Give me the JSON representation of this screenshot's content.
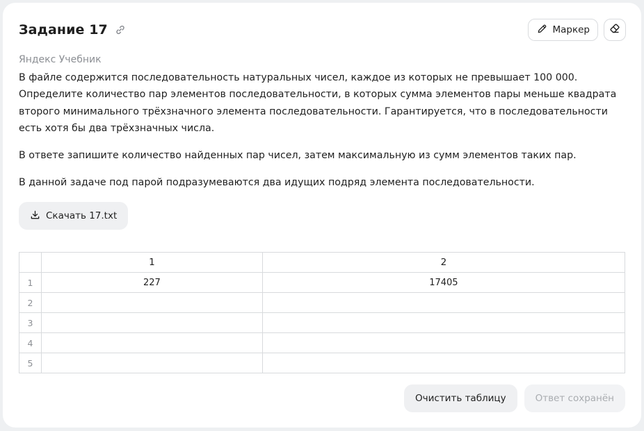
{
  "task": {
    "title": "Задание 17",
    "source": "Яндекс Учебник",
    "paragraphs": [
      "В файле содержится последовательность натуральных чисел, каждое из которых не превышает 100 000. Определите количество пар элементов последовательности, в которых сумма элементов пары меньше квадрата второго минимального трёхзначного элемента последовательности. Гарантируется, что в последовательности есть хотя бы два трёхзначных числа.",
      "В ответе запишите количество найденных пар чисел, затем максимальную из сумм элементов таких пар.",
      "В данной задаче под парой подразумеваются два идущих подряд элемента последовательности."
    ]
  },
  "toolbar": {
    "marker_label": "Маркер",
    "marker_icon": "pencil-icon",
    "eraser_icon": "eraser-icon",
    "link_icon": "link-icon"
  },
  "download": {
    "label": "Скачать 17.txt",
    "icon": "download-icon"
  },
  "answer_table": {
    "columns": [
      "1",
      "2"
    ],
    "rows": [
      {
        "index": "1",
        "cells": [
          "227",
          "17405"
        ]
      },
      {
        "index": "2",
        "cells": [
          "",
          ""
        ]
      },
      {
        "index": "3",
        "cells": [
          "",
          ""
        ]
      },
      {
        "index": "4",
        "cells": [
          "",
          ""
        ]
      },
      {
        "index": "5",
        "cells": [
          "",
          ""
        ]
      }
    ]
  },
  "actions": {
    "clear_label": "Очистить таблицу",
    "saved_label": "Ответ сохранён"
  }
}
